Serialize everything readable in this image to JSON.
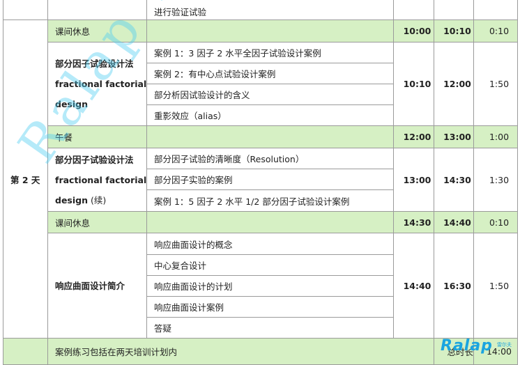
{
  "schedule": {
    "top_row": {
      "item": "进行验证试验"
    },
    "day_label": "第 2 天",
    "break1": {
      "label": "课间休息",
      "start": "10:00",
      "end": "10:10",
      "duration": "0:10"
    },
    "block1": {
      "title_cn": "部分因子试验设计法",
      "title_en1": "fractional factorial",
      "title_en2": "design",
      "items": [
        "案例 1：3 因子 2 水平全因子试验设计案例",
        "案例 2：有中心点试验设计案例",
        "部分析因试验设计的含义",
        "重影效应（alias）"
      ],
      "start": "10:10",
      "end": "12:00",
      "duration": "1:50"
    },
    "lunch": {
      "label": "午餐",
      "start": "12:00",
      "end": "13:00",
      "duration": "1:00"
    },
    "block2": {
      "title_cn": "部分因子试验设计法",
      "title_en1": "fractional factorial",
      "title_en2": "design",
      "title_suffix": " (续)",
      "items": [
        "部分因子试验的清晰度（Resolution）",
        "部分因子实验的案例",
        "案例 1：5 因子 2 水平 1/2 部分因子试验设计案例"
      ],
      "start": "13:00",
      "end": "14:30",
      "duration": "1:30"
    },
    "break2": {
      "label": "课间休息",
      "start": "14:30",
      "end": "14:40",
      "duration": "0:10"
    },
    "block3": {
      "title_cn": "响应曲面设计简介",
      "items": [
        "响应曲面设计的概念",
        "中心复合设计",
        "响应曲面设计的计划",
        "响应曲面设计案例",
        "答疑"
      ],
      "start": "14:40",
      "end": "16:30",
      "duration": "1:50"
    },
    "footer": {
      "note": "案例练习包括在两天培训计划内",
      "total_label": "总时长",
      "total_value": "14:00"
    }
  },
  "watermark": {
    "text": "Ralap Tech"
  },
  "logo": {
    "text": "Ralap",
    "sub": "雷尔夫"
  },
  "colors": {
    "green_row": "#d6f0c4",
    "border": "#9a9a9a",
    "watermark": "#4ecdf0",
    "logo": "#1aa4e0"
  }
}
